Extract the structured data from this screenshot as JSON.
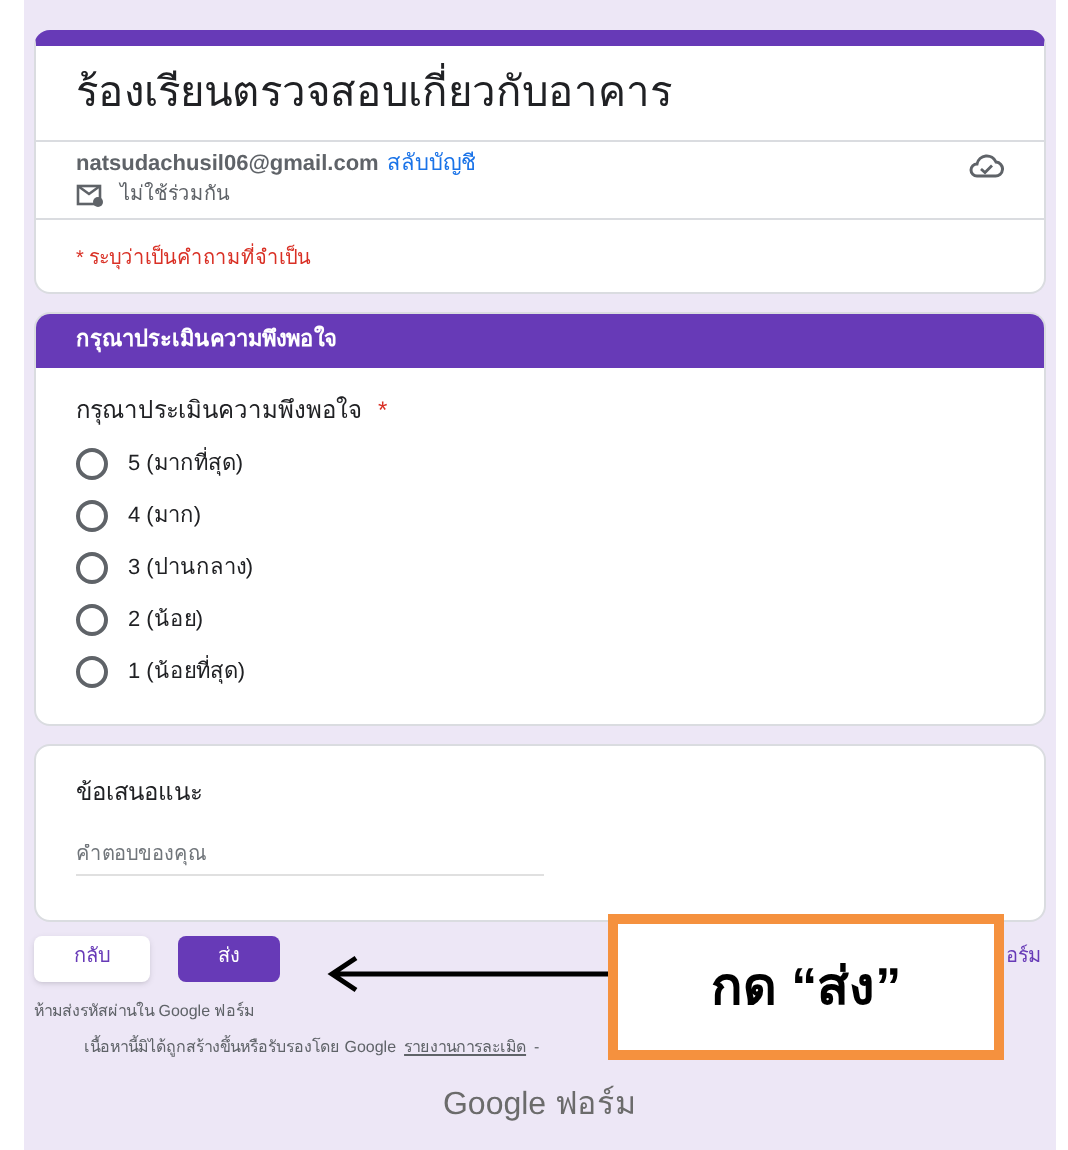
{
  "form": {
    "title": "ร้องเรียนตรวจสอบเกี่ยวกับอาคาร",
    "account_email": "natsudachusil06@gmail.com",
    "switch_account": "สลับบัญชี",
    "not_shared": "ไม่ใช้ร่วมกัน",
    "required_note": "* ระบุว่าเป็นคำถามที่จำเป็น"
  },
  "section": {
    "title": "กรุณาประเมินความพึงพอใจ"
  },
  "question": {
    "label": "กรุณาประเมินความพึงพอใจ",
    "required_mark": "*",
    "options": [
      {
        "label": "5 (มากที่สุด)",
        "selected": false
      },
      {
        "label": "4 (มาก)",
        "selected": false
      },
      {
        "label": "3 (ปานกลาง)",
        "selected": false
      },
      {
        "label": "2 (น้อย)",
        "selected": false
      },
      {
        "label": "1 (น้อยที่สุด)",
        "selected": false
      }
    ]
  },
  "comment": {
    "label": "ข้อเสนอแนะ",
    "placeholder": "คำตอบของคุณ"
  },
  "buttons": {
    "back": "กลับ",
    "submit": "ส่ง",
    "clear": "อร์ม"
  },
  "footer": {
    "password_warning": "ห้ามส่งรหัสผ่านใน Google ฟอร์ม",
    "disclaimer": "เนื้อหานี้มิได้ถูกสร้างขึ้นหรือรับรองโดย Google",
    "report_link": "รายงานการละเมิด",
    "separator": "-",
    "brand": "Google ฟอร์ม"
  },
  "callout": {
    "text": "กด “ส่ง”"
  }
}
